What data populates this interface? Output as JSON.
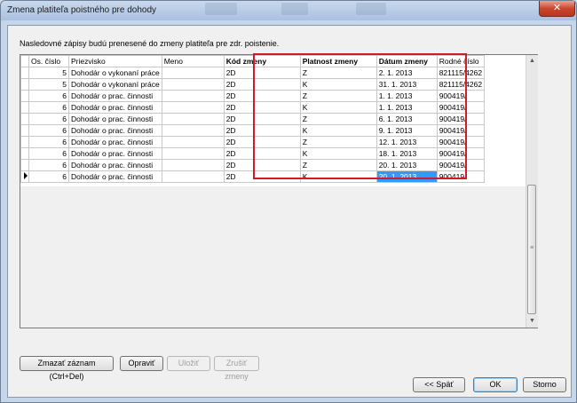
{
  "window": {
    "title": "Zmena platiteľa poistného pre dohody",
    "close_glyph": "✕"
  },
  "note": "Nasledovné zápisy budú prenesené do zmeny platiteľa pre zdr. poistenie.",
  "grid": {
    "columns": [
      "",
      "Os. číslo",
      "Priezvisko",
      "Meno",
      "Kód zmeny",
      "Platnost zmeny",
      "Dátum zmeny",
      "Rodné číslo"
    ],
    "rows": [
      {
        "os": "5",
        "priezvisko": "Dohodár o vykonaní práce",
        "meno": "",
        "kod": "2D",
        "platnost": "Z",
        "datum": "2. 1. 2013",
        "rc": "821115/4262"
      },
      {
        "os": "5",
        "priezvisko": "Dohodár o vykonaní práce",
        "meno": "",
        "kod": "2D",
        "platnost": "K",
        "datum": "31. 1. 2013",
        "rc": "821115/4262"
      },
      {
        "os": "6",
        "priezvisko": "Dohodár o prac. činnosti",
        "meno": "",
        "kod": "2D",
        "platnost": "Z",
        "datum": "1. 1. 2013",
        "rc": "900419/"
      },
      {
        "os": "6",
        "priezvisko": "Dohodár o prac. činnosti",
        "meno": "",
        "kod": "2D",
        "platnost": "K",
        "datum": "1. 1. 2013",
        "rc": "900419/"
      },
      {
        "os": "6",
        "priezvisko": "Dohodár o prac. činnosti",
        "meno": "",
        "kod": "2D",
        "platnost": "Z",
        "datum": "6. 1. 2013",
        "rc": "900419/"
      },
      {
        "os": "6",
        "priezvisko": "Dohodár o prac. činnosti",
        "meno": "",
        "kod": "2D",
        "platnost": "K",
        "datum": "9. 1. 2013",
        "rc": "900419/"
      },
      {
        "os": "6",
        "priezvisko": "Dohodár o prac. činnosti",
        "meno": "",
        "kod": "2D",
        "platnost": "Z",
        "datum": "12. 1. 2013",
        "rc": "900419/"
      },
      {
        "os": "6",
        "priezvisko": "Dohodár o prac. činnosti",
        "meno": "",
        "kod": "2D",
        "platnost": "K",
        "datum": "18. 1. 2013",
        "rc": "900419/"
      },
      {
        "os": "6",
        "priezvisko": "Dohodár o prac. činnosti",
        "meno": "",
        "kod": "2D",
        "platnost": "Z",
        "datum": "20. 1. 2013",
        "rc": "900419/"
      },
      {
        "os": "6",
        "priezvisko": "Dohodár o prac. činnosti",
        "meno": "",
        "kod": "2D",
        "platnost": "K",
        "datum": "20. 1. 2013",
        "rc": "900419/"
      }
    ],
    "current_row": 9,
    "selected_cell_color": "#3399ff",
    "highlight_color": "#d11a2a"
  },
  "scrollbar": {
    "up": "▲",
    "down": "▼",
    "grip": "≡"
  },
  "buttons": {
    "delete": "Zmazať záznam (Ctrl+Del)",
    "edit": "Opraviť",
    "save": "Uložiť",
    "cancel_changes": "Zrušiť zmeny",
    "back": "<< Späť",
    "ok": "OK",
    "storno": "Storno"
  }
}
